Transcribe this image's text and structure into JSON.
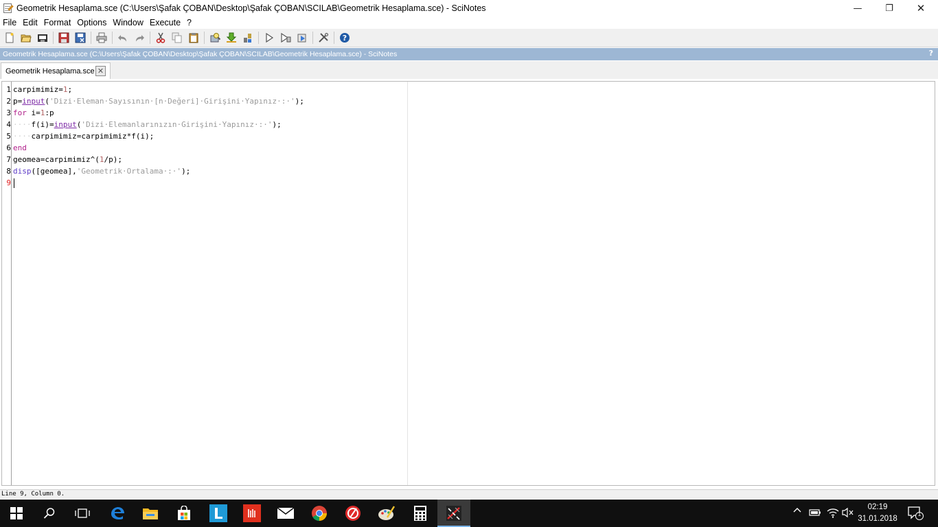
{
  "window": {
    "title": "Geometrik Hesaplama.sce (C:\\Users\\Şafak ÇOBAN\\Desktop\\Şafak ÇOBAN\\SCILAB\\Geometrik Hesaplama.sce) - SciNotes",
    "controls": {
      "minimize": "—",
      "restore": "❐",
      "close": "✕"
    }
  },
  "menu": [
    "File",
    "Edit",
    "Format",
    "Options",
    "Window",
    "Execute",
    "?"
  ],
  "toolbar": [
    "new-file-icon",
    "open-file-icon",
    "open-recent-icon",
    "save-icon",
    "save-as-icon",
    "print-icon",
    "undo-icon",
    "redo-icon",
    "cut-icon",
    "copy-icon",
    "paste-icon",
    "find-replace-icon",
    "load-into-scilab-icon",
    "execute-file-icon",
    "run-icon",
    "run-until-caret-icon",
    "run-selection-icon",
    "preferences-icon",
    "help-icon"
  ],
  "doc_header": {
    "title": "Geometrik Hesaplama.sce (C:\\Users\\Şafak ÇOBAN\\Desktop\\Şafak ÇOBAN\\SCILAB\\Geometrik Hesaplama.sce) - SciNotes",
    "help": "?"
  },
  "tab": {
    "label": "Geometrik Hesaplama.sce",
    "close": "✕"
  },
  "editor": {
    "line_numbers": [
      "1",
      "2",
      "3",
      "4",
      "5",
      "6",
      "7",
      "8",
      "9"
    ],
    "current_line": 9,
    "code": [
      [
        {
          "t": "carpimimiz="
        },
        {
          "t": "1",
          "c": "num"
        },
        {
          "t": ";"
        }
      ],
      [
        {
          "t": "p="
        },
        {
          "t": "input",
          "c": "fn"
        },
        {
          "t": "("
        },
        {
          "t": "'Dizi·Eleman·Sayısının·[n·Değeri]·Girişini·Yapınız·:·'",
          "c": "str"
        },
        {
          "t": ");"
        }
      ],
      [
        {
          "t": "for",
          "c": "kw"
        },
        {
          "t": " i="
        },
        {
          "t": "1",
          "c": "num"
        },
        {
          "t": ":p"
        }
      ],
      [
        {
          "t": "····",
          "c": "dot"
        },
        {
          "t": "f(i)="
        },
        {
          "t": "input",
          "c": "fn"
        },
        {
          "t": "("
        },
        {
          "t": "'Dizi·Elemanlarınızın·Girişini·Yapınız·:·'",
          "c": "str"
        },
        {
          "t": ");"
        }
      ],
      [
        {
          "t": "····",
          "c": "dot"
        },
        {
          "t": "carpimimiz=carpimimiz*f(i);"
        }
      ],
      [
        {
          "t": "end",
          "c": "kw"
        }
      ],
      [
        {
          "t": "geomea=carpimimiz^("
        },
        {
          "t": "1",
          "c": "num"
        },
        {
          "t": "/p);"
        }
      ],
      [
        {
          "t": "disp",
          "c": "bl"
        },
        {
          "t": "([geomea],"
        },
        {
          "t": "'Geometrik·Ortalama·:·'",
          "c": "str"
        },
        {
          "t": ");"
        }
      ],
      []
    ]
  },
  "status": "Line 9, Column 0.",
  "taskbar": {
    "apps": [
      "start-icon",
      "search-icon",
      "task-view-icon",
      "edge-icon",
      "file-explorer-icon",
      "store-icon",
      "l-app-icon",
      "red-app-icon",
      "mail-icon",
      "chrome-icon",
      "opera-icon",
      "paint-icon",
      "calculator-icon",
      "scilab-icon"
    ],
    "active": "scilab-icon",
    "time": "02:19",
    "date": "31.01.2018",
    "notification_count": "1"
  },
  "colors": {
    "doc_header_bg": "#9db7d4",
    "keyword": "#b0208a",
    "string": "#9a9a9a",
    "number": "#b46666",
    "function": "#7d2aa6",
    "builtin": "#5d3cc7"
  }
}
